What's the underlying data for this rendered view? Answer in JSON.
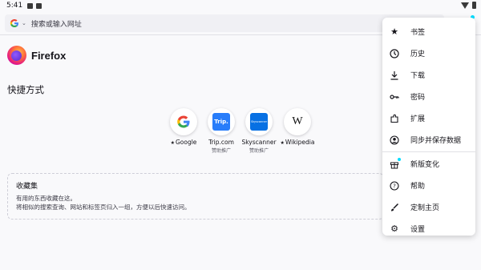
{
  "status": {
    "time": "5:41"
  },
  "urlbar": {
    "engine": "G",
    "placeholder": "搜索或输入网址"
  },
  "brand": {
    "name": "Firefox"
  },
  "shortcuts": {
    "title": "快捷方式",
    "items": [
      {
        "label": "Google",
        "sub": "",
        "pinned": true,
        "tile": "G"
      },
      {
        "label": "Trip.com",
        "sub": "赞助推广",
        "pinned": false,
        "tile": "Trip."
      },
      {
        "label": "Skyscanner",
        "sub": "赞助推广",
        "pinned": false,
        "tile": "Skyscanner"
      },
      {
        "label": "Wikipedia",
        "sub": "",
        "pinned": true,
        "tile": "W"
      }
    ]
  },
  "collections": {
    "title": "收藏集",
    "line1": "有用的东西收藏在这。",
    "line2": "将相似的搜索查询、网站和标签页归入一组，方便以后快速访问。"
  },
  "menu": {
    "items": [
      {
        "label": "书签",
        "icon": "bookmark-star-icon"
      },
      {
        "label": "历史",
        "icon": "history-clock-icon"
      },
      {
        "label": "下载",
        "icon": "download-icon"
      },
      {
        "label": "密码",
        "icon": "key-icon"
      },
      {
        "label": "扩展",
        "icon": "extensions-icon"
      },
      {
        "label": "同步并保存数据",
        "icon": "account-icon"
      },
      {
        "label": "新版变化",
        "icon": "gift-icon"
      },
      {
        "label": "帮助",
        "icon": "help-icon"
      },
      {
        "label": "定制主页",
        "icon": "brush-icon"
      },
      {
        "label": "设置",
        "icon": "settings-gear-icon"
      }
    ]
  },
  "colors": {
    "accent": "#00ddff",
    "background": "#f9f9fb"
  }
}
